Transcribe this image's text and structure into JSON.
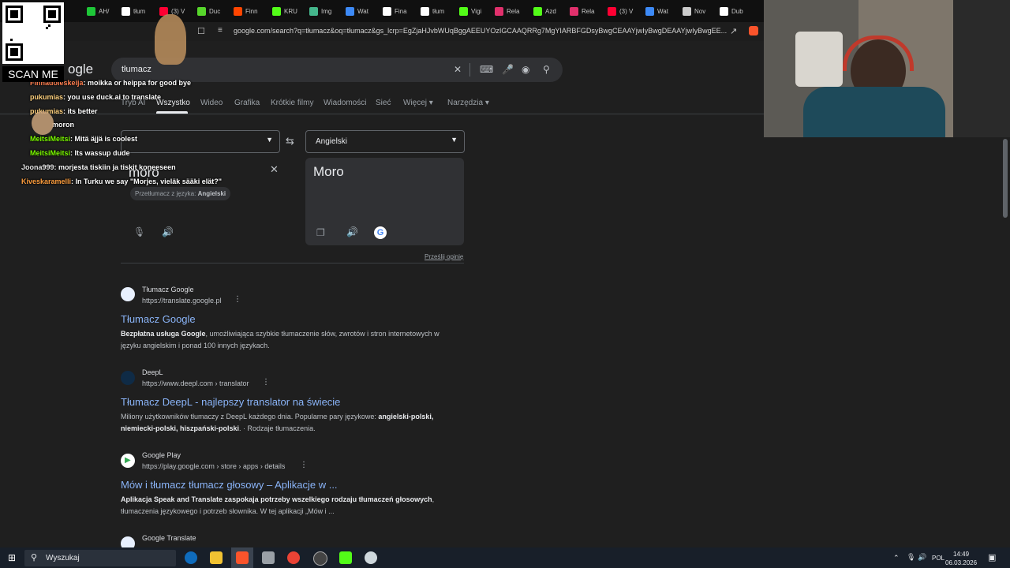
{
  "browser": {
    "tabs": [
      {
        "label": "AH/",
        "color": "#1ec738"
      },
      {
        "label": "tłum",
        "color": "#ffffff"
      },
      {
        "label": "(3) V",
        "color": "#ff0033"
      },
      {
        "label": "Duc",
        "color": "#57d62b"
      },
      {
        "label": "Finn",
        "color": "#ff4500"
      },
      {
        "label": "KRU",
        "color": "#53fc18"
      },
      {
        "label": "Img",
        "color": "#44b68c"
      },
      {
        "label": "Wat",
        "color": "#3d8af7"
      },
      {
        "label": "Fina",
        "color": "#ffffff"
      },
      {
        "label": "tłum",
        "color": "#ffffff"
      },
      {
        "label": "Vigi",
        "color": "#53fc18"
      },
      {
        "label": "Rela",
        "color": "#e1306c"
      },
      {
        "label": "Azd",
        "color": "#53fc18"
      },
      {
        "label": "Rela",
        "color": "#e1306c"
      },
      {
        "label": "(3) V",
        "color": "#ff0033"
      },
      {
        "label": "Wat",
        "color": "#3d8af7"
      },
      {
        "label": "Nov",
        "color": "#cccccc"
      },
      {
        "label": "Dub",
        "color": "#ffffff"
      }
    ],
    "url": "google.com/search?q=tłumacz&oq=tłumacz&gs_lcrp=EgZjaHJvbWUqBggAEEUYOzIGCAAQRRg7MgYIARBFGDsyBwgCEAAYjwIyBwgDEAAYjwIyBwgEE..."
  },
  "search": {
    "logo": "ogle",
    "query": "tłumacz"
  },
  "nav": {
    "items": [
      "Tryb AI",
      "Wszystko",
      "Wideo",
      "Grafika",
      "Krótkie filmy",
      "Wiadomości",
      "Sieć",
      "Więcej",
      "Narzędzia"
    ]
  },
  "translator": {
    "source_input": "moro",
    "target_lang": "Angielski",
    "source_chip_prefix": "Przetłumacz z języka: ",
    "source_chip_lang": "Angielski",
    "output": "Moro",
    "feedback": "Prześlij opinię"
  },
  "results": [
    {
      "site": "Tłumacz Google",
      "url": "https://translate.google.pl",
      "title": "Tłumacz Google",
      "snippet_bold": "Bezpłatna usługa Google",
      "snippet": ", umożliwiająca szybkie tłumaczenie słów, zwrotów i stron internetowych w języku angielskim i ponad 100 innych językach."
    },
    {
      "site": "DeepL",
      "url": "https://www.deepl.com › translator",
      "title": "Tłumacz DeepL - najlepszy translator na świecie",
      "snippet_a": "Miliony użytkowników tłumaczy z DeepL każdego dnia. Popularne pary językowe: ",
      "snippet_bold": "angielski-polski, niemiecki-polski, hiszpański-polski",
      "snippet_b": ". · Rodzaje tłumaczenia."
    },
    {
      "site": "Google Play",
      "url": "https://play.google.com › store › apps › details",
      "title": "Mów i tłumacz tłumacz głosowy – Aplikacje w ...",
      "snippet_bold": "Aplikacja Speak and Translate zaspokaja potrzeby wszelkiego rodzaju tłumaczeń głosowych",
      "snippet": ", tłumaczenia językowego i potrzeb słownika. W tej aplikacji „Mów i ..."
    },
    {
      "site": "Google Translate"
    }
  ],
  "chat": [
    {
      "user": "Finhadoleskeija",
      "msg": "moikka or heippa for good bye",
      "color": "#ff7f50"
    },
    {
      "user": "pukumias",
      "msg": "you use duck.ai to translate",
      "color": "#ffd27f"
    },
    {
      "user": "pukumias",
      "msg": "its better",
      "color": "#ffd27f"
    },
    {
      "user": "",
      "msg": "moron",
      "color": "#ffffff"
    },
    {
      "user": "MeitsiMeitsi",
      "msg": "Mitä äjjä is coolest",
      "color": "#7cfc00"
    },
    {
      "user": "MeitsiMeitsi",
      "msg": "Its wassup dude",
      "color": "#7cfc00"
    },
    {
      "user": "Joona999",
      "msg": "morjesta tiskiin ja tiskit koneeseen",
      "color": "#e8e8e8"
    },
    {
      "user": "Kiveskaramelli",
      "msg": "In Turku we say \"Morjes, vieläk sääki elät?\"",
      "color": "#ff9f3f"
    }
  ],
  "overlay": {
    "scan_me": "SCAN ME"
  },
  "taskbar": {
    "search_placeholder": "Wyszukaj",
    "lang": "POL",
    "time": "14:49",
    "date": "06.03.2026"
  }
}
